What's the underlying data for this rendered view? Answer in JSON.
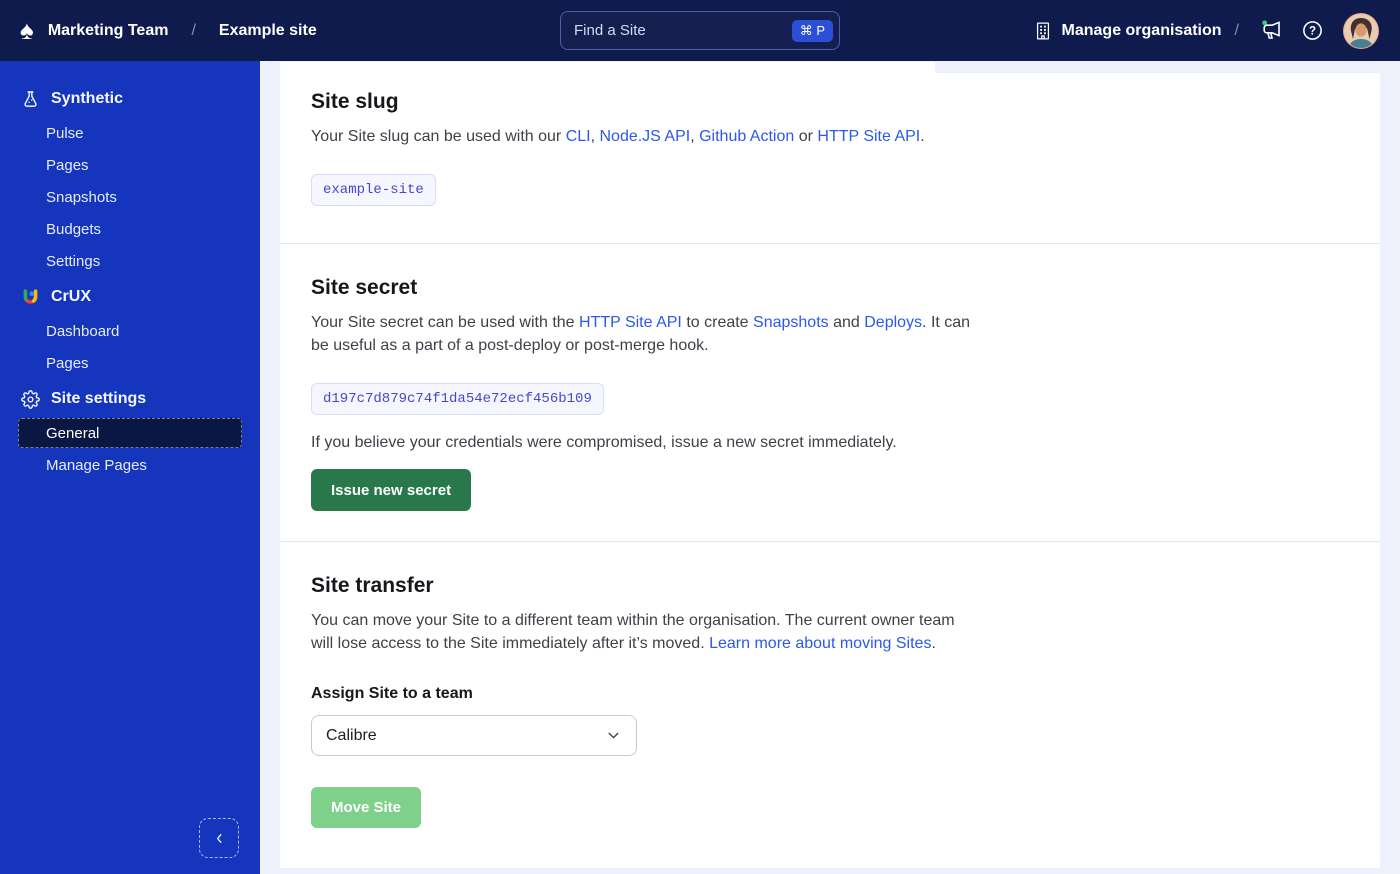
{
  "header": {
    "logo_icon": "spade-logo-icon",
    "team_name": "Marketing Team",
    "breadcrumb_separator": "/",
    "site_name": "Example site",
    "search": {
      "placeholder": "Find a Site",
      "shortcut": "⌘ P"
    },
    "manage_organisation_label": "Manage organisation",
    "trailing_separator": "/"
  },
  "sidebar": {
    "sections": [
      {
        "label": "Synthetic",
        "icon": "flask-icon",
        "items": [
          "Pulse",
          "Pages",
          "Snapshots",
          "Budgets",
          "Settings"
        ]
      },
      {
        "label": "CrUX",
        "icon": "crux-logo-icon",
        "items": [
          "Dashboard",
          "Pages"
        ]
      },
      {
        "label": "Site settings",
        "icon": "gear-icon",
        "items": [
          "General",
          "Manage Pages"
        ],
        "active_item": "General"
      }
    ]
  },
  "main": {
    "site_slug": {
      "title": "Site slug",
      "p": [
        "Your Site slug can be used with our ",
        "CLI",
        ", ",
        "Node.JS API",
        ", ",
        "Github Action",
        " or ",
        "HTTP Site API",
        "."
      ],
      "slug": "example-site"
    },
    "site_secret": {
      "title": "Site secret",
      "p": [
        "Your Site secret can be used with the ",
        "HTTP Site API",
        " to create ",
        "Snapshots",
        " and ",
        "Deploys",
        ". It can be useful as a part of a post-deploy or post-merge hook."
      ],
      "secret": "d197c7d879c74f1da54e72ecf456b109",
      "warning": "If you believe your credentials were compromised, issue a new secret immediately.",
      "issue_button_label": "Issue new secret"
    },
    "site_transfer": {
      "title": "Site transfer",
      "p": [
        "You can move your Site to a different team within the organisation. The current owner team will lose access to the Site immediately after it’s moved. ",
        "Learn more about moving Sites",
        "."
      ],
      "assign_label": "Assign Site to a team",
      "team_select_value": "Calibre",
      "move_button_label": "Move Site"
    }
  },
  "colors": {
    "header-bg": "#101b4d",
    "sidebar-bg": "#1535bd",
    "sidebar-active-bg": "#0b1743",
    "page-bg": "#eef1fb",
    "card-bg": "#ffffff",
    "link": "#2b59e8",
    "code-text": "#4747cb",
    "code-bg": "#f6f7fe",
    "code-border": "#d9dcf6",
    "primary-green": "#28784b",
    "disabled-green": "#7ed08a",
    "shortcut-badge": "#2b4fd7"
  }
}
